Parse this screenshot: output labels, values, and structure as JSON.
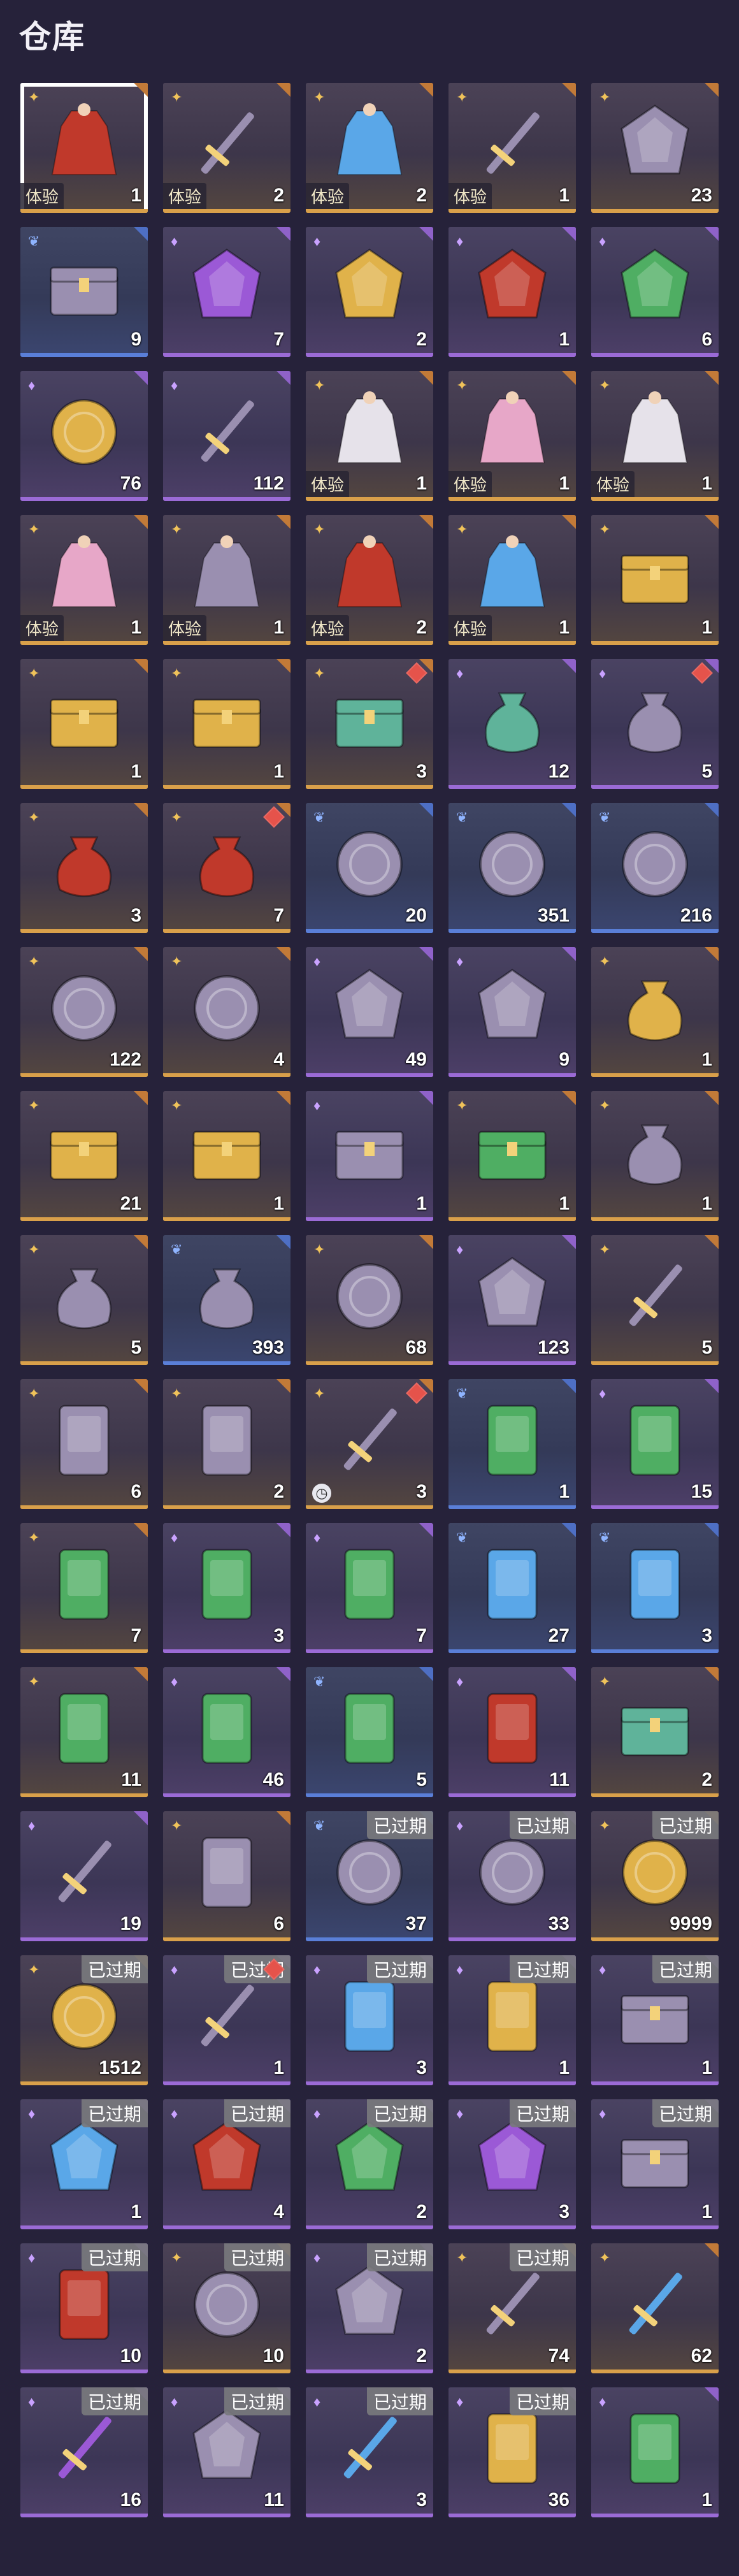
{
  "title": "仓库",
  "colors": {
    "gold": "#d9a04a",
    "purple": "#9b6bd6",
    "blue": "#5a7fd8",
    "background": "#26223a"
  },
  "items": [
    {
      "icon": "red-armor",
      "rarity": "gold",
      "count": "1",
      "tag": "体验",
      "selected": true
    },
    {
      "icon": "spear",
      "rarity": "gold",
      "count": "2",
      "tag": "体验"
    },
    {
      "icon": "blue-robe",
      "rarity": "gold",
      "count": "2",
      "tag": "体验"
    },
    {
      "icon": "sword",
      "rarity": "gold",
      "count": "1",
      "tag": "体验"
    },
    {
      "icon": "crystal",
      "rarity": "gold",
      "count": "23"
    },
    {
      "icon": "jewel-box",
      "rarity": "blue",
      "count": "9"
    },
    {
      "icon": "purple-gem",
      "rarity": "purple",
      "count": "7"
    },
    {
      "icon": "gold-gem",
      "rarity": "purple",
      "count": "2"
    },
    {
      "icon": "red-dodecahedron",
      "rarity": "purple",
      "count": "1"
    },
    {
      "icon": "green-dodecahedron",
      "rarity": "purple",
      "count": "6"
    },
    {
      "icon": "gold-coin",
      "rarity": "purple",
      "count": "76"
    },
    {
      "icon": "hammer",
      "rarity": "purple",
      "count": "112"
    },
    {
      "icon": "white-robe",
      "rarity": "gold",
      "count": "1",
      "tag": "体验"
    },
    {
      "icon": "pink-robe",
      "rarity": "gold",
      "count": "1",
      "tag": "体验"
    },
    {
      "icon": "white-dress",
      "rarity": "gold",
      "count": "1",
      "tag": "体验"
    },
    {
      "icon": "pink-dress",
      "rarity": "gold",
      "count": "1",
      "tag": "体验"
    },
    {
      "icon": "peach-robe",
      "rarity": "gold",
      "count": "1",
      "tag": "体验"
    },
    {
      "icon": "red-armor",
      "rarity": "gold",
      "count": "2",
      "tag": "体验"
    },
    {
      "icon": "blue-robe",
      "rarity": "gold",
      "count": "1",
      "tag": "体验"
    },
    {
      "icon": "gold-chest",
      "rarity": "gold",
      "count": "1"
    },
    {
      "icon": "gold-chest",
      "rarity": "gold",
      "count": "1"
    },
    {
      "icon": "gold-chest",
      "rarity": "gold",
      "count": "1"
    },
    {
      "icon": "jade-chest",
      "rarity": "gold",
      "count": "3",
      "new": true
    },
    {
      "icon": "jade-vessel",
      "rarity": "purple",
      "count": "12"
    },
    {
      "icon": "gourd",
      "rarity": "purple",
      "count": "5",
      "new": true
    },
    {
      "icon": "red-pouch",
      "rarity": "gold",
      "count": "3"
    },
    {
      "icon": "red-pouch",
      "rarity": "gold",
      "count": "7",
      "new": true
    },
    {
      "icon": "flame-orb",
      "rarity": "blue",
      "count": "20"
    },
    {
      "icon": "lotus",
      "rarity": "blue",
      "count": "351"
    },
    {
      "icon": "powder-bowl",
      "rarity": "blue",
      "count": "216"
    },
    {
      "icon": "tri-color-plate",
      "rarity": "gold",
      "count": "122"
    },
    {
      "icon": "rainbow-mirror",
      "rarity": "gold",
      "count": "4"
    },
    {
      "icon": "puzzle-piece",
      "rarity": "purple",
      "count": "49"
    },
    {
      "icon": "feather-beast",
      "rarity": "purple",
      "count": "9"
    },
    {
      "icon": "gold-pouch",
      "rarity": "gold",
      "count": "1"
    },
    {
      "icon": "gold-chest",
      "rarity": "gold",
      "count": "21"
    },
    {
      "icon": "gold-chest",
      "rarity": "gold",
      "count": "1"
    },
    {
      "icon": "gift-box",
      "rarity": "purple",
      "count": "1"
    },
    {
      "icon": "green-chest",
      "rarity": "gold",
      "count": "1"
    },
    {
      "icon": "lucky-bag",
      "rarity": "gold",
      "count": "1"
    },
    {
      "icon": "lucky-bag",
      "rarity": "gold",
      "count": "5"
    },
    {
      "icon": "colorful-bag",
      "rarity": "blue",
      "count": "393"
    },
    {
      "icon": "compass",
      "rarity": "gold",
      "count": "68"
    },
    {
      "icon": "kite",
      "rarity": "purple",
      "count": "123"
    },
    {
      "icon": "firecracker",
      "rarity": "gold",
      "count": "5"
    },
    {
      "icon": "portrait-man",
      "rarity": "gold",
      "count": "6"
    },
    {
      "icon": "portrait-woman",
      "rarity": "gold",
      "count": "2"
    },
    {
      "icon": "key",
      "rarity": "gold",
      "count": "3",
      "new": true,
      "clock": true
    },
    {
      "icon": "green-token-50",
      "rarity": "blue",
      "count": "1"
    },
    {
      "icon": "green-token-200",
      "rarity": "purple",
      "count": "15"
    },
    {
      "icon": "green-token-100",
      "rarity": "gold",
      "count": "7"
    },
    {
      "icon": "green-token-100",
      "rarity": "purple",
      "count": "3"
    },
    {
      "icon": "green-token-100",
      "rarity": "purple",
      "count": "7"
    },
    {
      "icon": "blue-token-100",
      "rarity": "blue",
      "count": "27"
    },
    {
      "icon": "blue-token-50",
      "rarity": "blue",
      "count": "3"
    },
    {
      "icon": "green-token-100",
      "rarity": "gold",
      "count": "11"
    },
    {
      "icon": "green-token-100",
      "rarity": "purple",
      "count": "46"
    },
    {
      "icon": "green-token-100",
      "rarity": "blue",
      "count": "5"
    },
    {
      "icon": "red-card",
      "rarity": "purple",
      "count": "11"
    },
    {
      "icon": "jade-box",
      "rarity": "gold",
      "count": "2"
    },
    {
      "icon": "horn",
      "rarity": "purple",
      "count": "19"
    },
    {
      "icon": "scroll",
      "rarity": "gold",
      "count": "6"
    },
    {
      "icon": "silver-medal",
      "rarity": "blue",
      "count": "37",
      "expired": "已过期"
    },
    {
      "icon": "heart",
      "rarity": "purple",
      "count": "33",
      "expired": "已过期"
    },
    {
      "icon": "gold-feather-coin",
      "rarity": "gold",
      "count": "9999",
      "expired": "已过期"
    },
    {
      "icon": "gold-feather-coin",
      "rarity": "gold",
      "count": "1512",
      "expired": "已过期"
    },
    {
      "icon": "bone",
      "rarity": "purple",
      "count": "1",
      "expired": "已过期",
      "new": true
    },
    {
      "icon": "blue-paper",
      "rarity": "purple",
      "count": "3",
      "expired": "已过期"
    },
    {
      "icon": "gold-paper",
      "rarity": "purple",
      "count": "1",
      "expired": "已过期"
    },
    {
      "icon": "flower-gift",
      "rarity": "purple",
      "count": "1",
      "expired": "已过期"
    },
    {
      "icon": "blue-flame-crystal",
      "rarity": "purple",
      "count": "1",
      "expired": "已过期"
    },
    {
      "icon": "red-flame-crystal",
      "rarity": "purple",
      "count": "4",
      "expired": "已过期"
    },
    {
      "icon": "green-flame-crystal",
      "rarity": "purple",
      "count": "2",
      "expired": "已过期"
    },
    {
      "icon": "purple-flame-crystal",
      "rarity": "purple",
      "count": "3",
      "expired": "已过期"
    },
    {
      "icon": "flower-gift",
      "rarity": "purple",
      "count": "1",
      "expired": "已过期"
    },
    {
      "icon": "red-tag",
      "rarity": "purple",
      "count": "10",
      "expired": "已过期"
    },
    {
      "icon": "fire-orb",
      "rarity": "gold",
      "count": "10",
      "expired": "已过期"
    },
    {
      "icon": "stone-tablet",
      "rarity": "purple",
      "count": "2",
      "expired": "已过期"
    },
    {
      "icon": "dagger",
      "rarity": "gold",
      "count": "74",
      "expired": "已过期"
    },
    {
      "icon": "blue-key",
      "rarity": "gold",
      "count": "62"
    },
    {
      "icon": "purple-key",
      "rarity": "purple",
      "count": "16",
      "expired": "已过期"
    },
    {
      "icon": "lantern-charm",
      "rarity": "purple",
      "count": "11",
      "expired": "已过期"
    },
    {
      "icon": "blue-key",
      "rarity": "purple",
      "count": "3",
      "expired": "已过期"
    },
    {
      "icon": "gold-ticket",
      "rarity": "purple",
      "count": "36",
      "expired": "已过期"
    },
    {
      "icon": "green-book",
      "rarity": "purple",
      "count": "1"
    }
  ]
}
